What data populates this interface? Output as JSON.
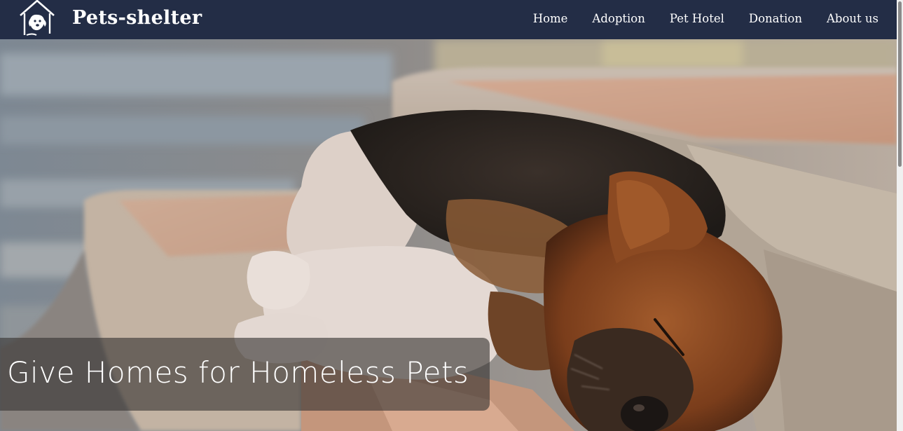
{
  "header": {
    "brand": "Pets-shelter",
    "logo_icon": "house-with-dog-icon",
    "nav": [
      {
        "label": "Home"
      },
      {
        "label": "Adoption"
      },
      {
        "label": "Pet Hotel"
      },
      {
        "label": "Donation"
      },
      {
        "label": "About us"
      }
    ],
    "background_color": "#232d46"
  },
  "hero": {
    "image": "sleeping-dog-on-steps-photo",
    "caption": "Give Homes for Homeless Pets"
  }
}
